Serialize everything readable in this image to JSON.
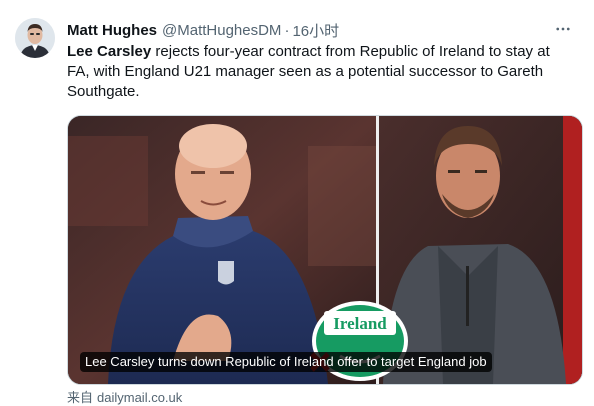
{
  "author": {
    "display_name": "Matt Hughes",
    "handle": "@MattHughesDM",
    "separator": "·",
    "time": "16小时"
  },
  "tweet": {
    "bold_name": "Lee Carsley",
    "text_rest": " rejects four-year contract from Republic of Ireland to stay at FA, with England U21 manager seen as a potential successor to Gareth Southgate."
  },
  "media": {
    "caption": "Lee Carsley turns down Republic of Ireland offer to target England job",
    "logo_text": "Ireland"
  },
  "source": {
    "label": "来自",
    "domain": "dailymail.co.uk"
  },
  "icons": {
    "more": "more-horizontal-icon"
  },
  "colors": {
    "text": "#0f1419",
    "secondary": "#536471",
    "border": "#cfd9de",
    "ireland_green": "#169b62"
  }
}
